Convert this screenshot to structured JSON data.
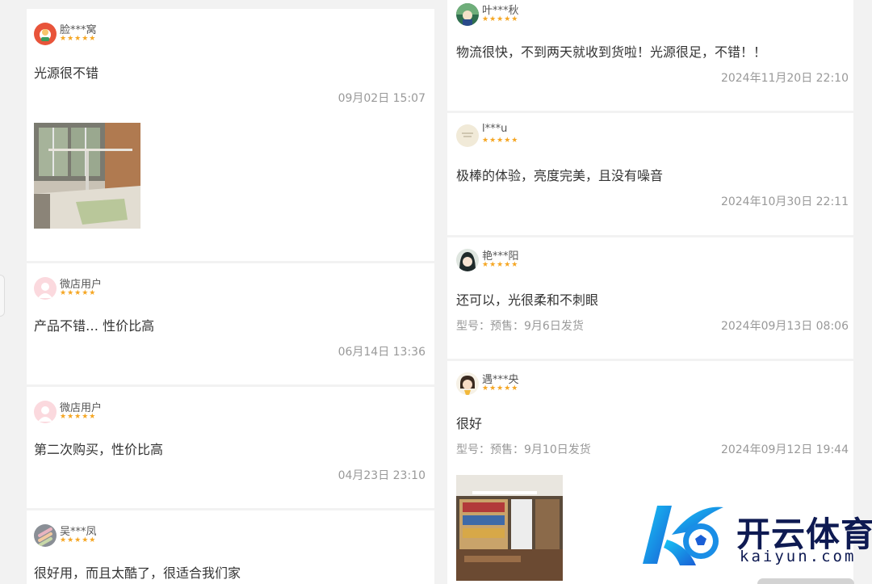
{
  "left_reviews": [
    {
      "user": "脸***窝",
      "stars": "★★★★★",
      "text": "光源很不错",
      "time": "09月02日 15:07"
    },
    {
      "user": "微店用户",
      "stars": "★★★★★",
      "text": "产品不错… 性价比高",
      "time": "06月14日 13:36"
    },
    {
      "user": "微店用户",
      "stars": "★★★★★",
      "text": "第二次购买，性价比高",
      "time": "04月23日 23:10"
    },
    {
      "user": "吴***凤",
      "stars": "★★★★★",
      "text": "很好用，而且太酷了，很适合我们家",
      "time": ""
    }
  ],
  "right_reviews": [
    {
      "user": "叶***秋",
      "stars": "★★★★★",
      "text": "物流很快，不到两天就收到货啦！光源很足，不错！！",
      "meta": "",
      "time": "2024年11月20日 22:10"
    },
    {
      "user": "l***u",
      "stars": "★★★★★",
      "text": "极棒的体验，亮度完美，且没有噪音",
      "meta": "",
      "time": "2024年10月30日 22:11"
    },
    {
      "user": "艳***阳",
      "stars": "★★★★★",
      "text": "还可以，光很柔和不刺眼",
      "meta": "型号：预售：9月6日发货",
      "time": "2024年09月13日 08:06"
    },
    {
      "user": "遇***央",
      "stars": "★★★★★",
      "text": "很好",
      "meta": "型号：预售：9月10日发货",
      "time": "2024年09月12日 19:44"
    }
  ],
  "watermark": {
    "cn": "开云体育",
    "en": "kaiyun.com",
    "logo_letter": "K"
  },
  "colors": {
    "star": "#f5a623",
    "time": "#999999",
    "card": "#ffffff",
    "background": "#f2f2f2",
    "brand": "#1e7fe0"
  }
}
